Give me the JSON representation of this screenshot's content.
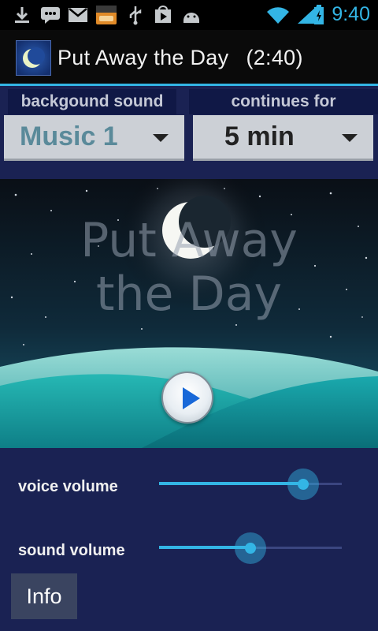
{
  "status_bar": {
    "time": "9:40",
    "icons": [
      "download-icon",
      "messages-icon",
      "gmail-icon",
      "amazon-appstore-icon",
      "usb-icon",
      "play-store-icon",
      "android-icon",
      "wifi-icon",
      "battery-icon"
    ],
    "accent_color": "#33b5e5"
  },
  "header": {
    "title": "Put Away the Day",
    "duration": "(2:40)"
  },
  "background_sound": {
    "label": "backgound sound",
    "value": "Music 1",
    "value_color": "#5a8a9a"
  },
  "continues_for": {
    "label": "continues for",
    "value": "5 min",
    "value_color": "#222222"
  },
  "scene": {
    "title_line1": "Put Away",
    "title_line2": "the Day",
    "play_icon": "play-icon"
  },
  "voice_volume": {
    "label": "voice volume",
    "level": 0.79
  },
  "sound_volume": {
    "label": "sound volume",
    "level": 0.5
  },
  "info_button": {
    "label": "Info"
  }
}
